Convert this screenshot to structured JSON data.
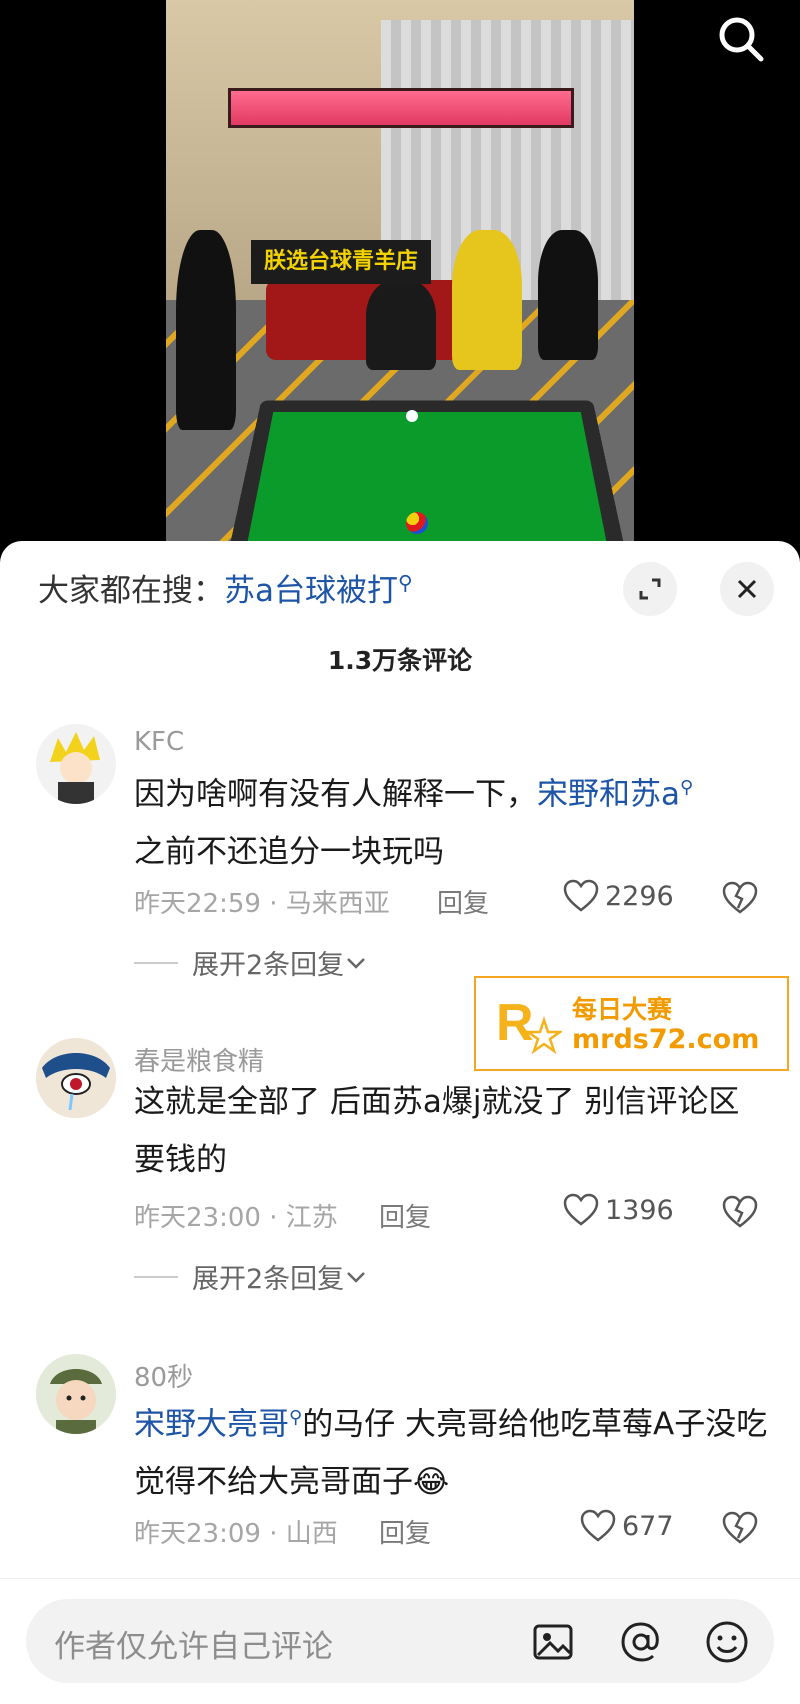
{
  "video": {
    "store_label": "朕选台球青羊店"
  },
  "sheet": {
    "trending_prefix": "大家都在搜：",
    "trending_query": "苏a台球被打",
    "comment_count": "1.3万条评论"
  },
  "comments": [
    {
      "user": "KFC",
      "text_a": "因为啥啊有没有人解释一下，",
      "mention": "宋野和苏a",
      "text_b": "之前不还追分一块玩吗",
      "time_loc": "昨天22:59 · 马来西亚",
      "reply": "回复",
      "likes": "2296",
      "expand": "展开2条回复"
    },
    {
      "user": "春是粮食精",
      "text_a": "这就是全部了 后面苏a爆j就没了  别信评论区要钱的",
      "time_loc": "昨天23:00 · 江苏",
      "reply": "回复",
      "likes": "1396",
      "expand": "展开2条回复"
    },
    {
      "user": "80秒",
      "mention": "宋野大亮哥",
      "text_a": "的马仔 大亮哥给他吃草莓A子没吃 觉得不给大亮哥面子",
      "emoji": "😂",
      "time_loc": "昨天23:09 · 山西",
      "reply": "回复",
      "likes": "677"
    }
  ],
  "watermark": {
    "line1": "每日大赛",
    "line2": "mrds72.com",
    "logo_small": "每日大赛"
  },
  "input": {
    "placeholder": "作者仅允许自己评论"
  },
  "icons": [
    "search-icon",
    "expand-icon",
    "close-icon",
    "heart-icon",
    "dislike-icon",
    "chevron-down-icon",
    "image-icon",
    "at-icon",
    "emoji-icon"
  ]
}
